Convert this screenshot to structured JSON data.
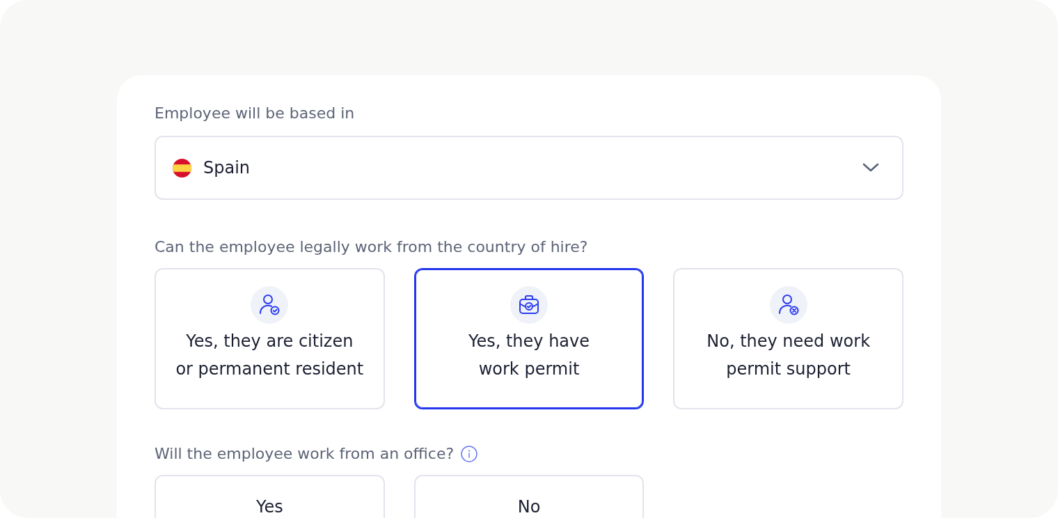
{
  "country_field": {
    "label": "Employee will be based in",
    "value": "Spain"
  },
  "questions": [
    {
      "label": "Can the employee legally work from the country of hire?",
      "info": false,
      "options": [
        {
          "kind": "person-check",
          "label": "Yes, they are citizen\nor permanent resident",
          "selected": false
        },
        {
          "kind": "briefcase-check",
          "label": "Yes, they have\nwork permit",
          "selected": true
        },
        {
          "kind": "person-cross",
          "label": "No, they need work\npermit support",
          "selected": false
        }
      ]
    },
    {
      "label": "Will the employee work from an office?",
      "info": true,
      "options": [
        {
          "kind": "plain",
          "label": "Yes",
          "selected": false
        },
        {
          "kind": "plain",
          "label": "No",
          "selected": false
        }
      ]
    }
  ]
}
